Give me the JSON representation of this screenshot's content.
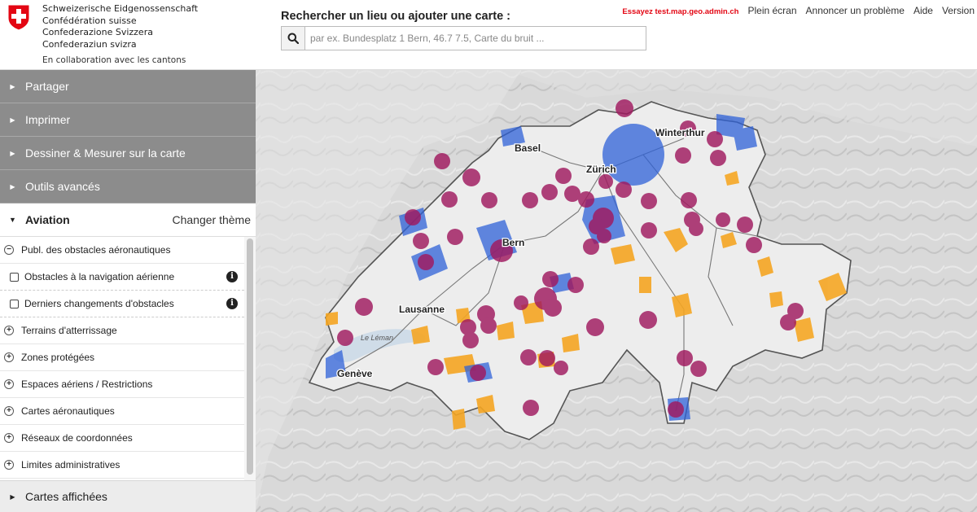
{
  "header": {
    "org_lines": [
      "Schweizerische Eidgenossenschaft",
      "Confédération suisse",
      "Confederazione Svizzera",
      "Confederaziun svizra"
    ],
    "collab": "En collaboration avec les cantons",
    "search_title": "Rechercher un lieu ou ajouter une carte :",
    "search_placeholder": "par ex. Bundesplatz 1 Bern, 46.7 7.5, Carte du bruit ...",
    "links": {
      "try": "Essayez test.map.geo.admin.ch",
      "fullscreen": "Plein écran",
      "report": "Annoncer un problème",
      "help": "Aide",
      "version": "Version"
    }
  },
  "sidebar": {
    "panels": [
      "Partager",
      "Imprimer",
      "Dessiner & Mesurer sur la carte",
      "Outils avancés"
    ],
    "theme": {
      "name": "Aviation",
      "change": "Changer thème"
    },
    "tree": {
      "group1": "Publ. des obstacles aéronautiques",
      "layer1": "Obstacles à la navigation aérienne",
      "layer2": "Derniers changements d'obstacles",
      "group2": "Terrains d'atterrissage",
      "group3": "Zones protégées",
      "group4": "Espaces aériens / Restrictions",
      "group5": "Cartes aéronautiques",
      "group6": "Réseaux de coordonnées",
      "group7": "Limites administratives"
    },
    "displayed": "Cartes affichées"
  },
  "map": {
    "cities": {
      "basel": "Basel",
      "zurich": "Zürich",
      "winterthur": "Winterthur",
      "bern": "Bern",
      "lausanne": "Lausanne",
      "geneve": "Genève"
    },
    "lake_leman": "Le Léman",
    "colors": {
      "obstacle": "#a0195f",
      "zone": "#2f62d8",
      "area": "#f5a623"
    }
  }
}
